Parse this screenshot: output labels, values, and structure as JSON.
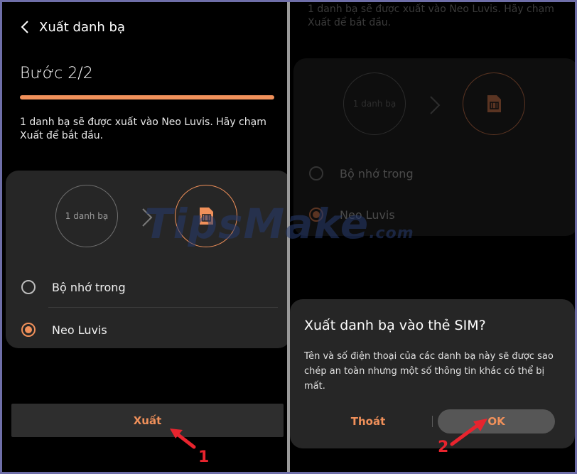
{
  "left_screen": {
    "appbar": {
      "title": "Xuất danh bạ"
    },
    "step_title": "Bước 2/2",
    "description": "1 danh bạ sẽ được xuất vào Neo Luvis. Hãy chạm Xuất để bắt đầu.",
    "source_label": "1 danh bạ",
    "options": [
      {
        "label": "Bộ nhớ trong",
        "selected": false
      },
      {
        "label": "Neo Luvis",
        "selected": true
      }
    ],
    "export_button": "Xuất"
  },
  "right_screen": {
    "description": "1 danh bạ sẽ được xuất vào Neo Luvis. Hãy chạm Xuất để bắt đầu.",
    "source_label": "1 danh bạ",
    "options": [
      {
        "label": "Bộ nhớ trong",
        "selected": false
      },
      {
        "label": "Neo Luvis",
        "selected": true
      }
    ],
    "dialog": {
      "title": "Xuất danh bạ vào thẻ SIM?",
      "message": "Tên và số điện thoại của các danh bạ này sẽ được sao chép an toàn nhưng một số thông tin khác có thể bị mất.",
      "cancel": "Thoát",
      "ok": "OK"
    }
  },
  "watermark": {
    "main": "TipsMake",
    "suffix": ".com"
  },
  "callouts": [
    "1",
    "2"
  ],
  "icons": [
    "back-arrow-icon",
    "chevron-right-icon",
    "sim-card-icon"
  ],
  "colors": {
    "accent": "#f0905a",
    "callout": "#e8242e",
    "background": "#000000"
  }
}
